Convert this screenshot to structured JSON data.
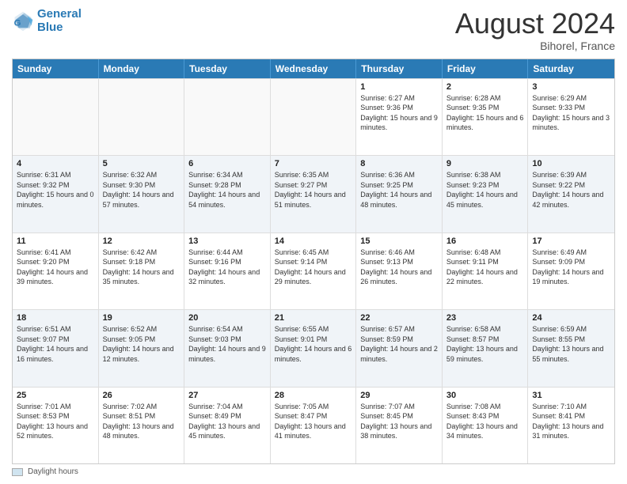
{
  "header": {
    "logo_line1": "General",
    "logo_line2": "Blue",
    "month": "August 2024",
    "location": "Bihorel, France"
  },
  "calendar": {
    "days_of_week": [
      "Sunday",
      "Monday",
      "Tuesday",
      "Wednesday",
      "Thursday",
      "Friday",
      "Saturday"
    ],
    "rows": [
      [
        {
          "day": "",
          "info": ""
        },
        {
          "day": "",
          "info": ""
        },
        {
          "day": "",
          "info": ""
        },
        {
          "day": "",
          "info": ""
        },
        {
          "day": "1",
          "info": "Sunrise: 6:27 AM\nSunset: 9:36 PM\nDaylight: 15 hours and 9 minutes."
        },
        {
          "day": "2",
          "info": "Sunrise: 6:28 AM\nSunset: 9:35 PM\nDaylight: 15 hours and 6 minutes."
        },
        {
          "day": "3",
          "info": "Sunrise: 6:29 AM\nSunset: 9:33 PM\nDaylight: 15 hours and 3 minutes."
        }
      ],
      [
        {
          "day": "4",
          "info": "Sunrise: 6:31 AM\nSunset: 9:32 PM\nDaylight: 15 hours and 0 minutes."
        },
        {
          "day": "5",
          "info": "Sunrise: 6:32 AM\nSunset: 9:30 PM\nDaylight: 14 hours and 57 minutes."
        },
        {
          "day": "6",
          "info": "Sunrise: 6:34 AM\nSunset: 9:28 PM\nDaylight: 14 hours and 54 minutes."
        },
        {
          "day": "7",
          "info": "Sunrise: 6:35 AM\nSunset: 9:27 PM\nDaylight: 14 hours and 51 minutes."
        },
        {
          "day": "8",
          "info": "Sunrise: 6:36 AM\nSunset: 9:25 PM\nDaylight: 14 hours and 48 minutes."
        },
        {
          "day": "9",
          "info": "Sunrise: 6:38 AM\nSunset: 9:23 PM\nDaylight: 14 hours and 45 minutes."
        },
        {
          "day": "10",
          "info": "Sunrise: 6:39 AM\nSunset: 9:22 PM\nDaylight: 14 hours and 42 minutes."
        }
      ],
      [
        {
          "day": "11",
          "info": "Sunrise: 6:41 AM\nSunset: 9:20 PM\nDaylight: 14 hours and 39 minutes."
        },
        {
          "day": "12",
          "info": "Sunrise: 6:42 AM\nSunset: 9:18 PM\nDaylight: 14 hours and 35 minutes."
        },
        {
          "day": "13",
          "info": "Sunrise: 6:44 AM\nSunset: 9:16 PM\nDaylight: 14 hours and 32 minutes."
        },
        {
          "day": "14",
          "info": "Sunrise: 6:45 AM\nSunset: 9:14 PM\nDaylight: 14 hours and 29 minutes."
        },
        {
          "day": "15",
          "info": "Sunrise: 6:46 AM\nSunset: 9:13 PM\nDaylight: 14 hours and 26 minutes."
        },
        {
          "day": "16",
          "info": "Sunrise: 6:48 AM\nSunset: 9:11 PM\nDaylight: 14 hours and 22 minutes."
        },
        {
          "day": "17",
          "info": "Sunrise: 6:49 AM\nSunset: 9:09 PM\nDaylight: 14 hours and 19 minutes."
        }
      ],
      [
        {
          "day": "18",
          "info": "Sunrise: 6:51 AM\nSunset: 9:07 PM\nDaylight: 14 hours and 16 minutes."
        },
        {
          "day": "19",
          "info": "Sunrise: 6:52 AM\nSunset: 9:05 PM\nDaylight: 14 hours and 12 minutes."
        },
        {
          "day": "20",
          "info": "Sunrise: 6:54 AM\nSunset: 9:03 PM\nDaylight: 14 hours and 9 minutes."
        },
        {
          "day": "21",
          "info": "Sunrise: 6:55 AM\nSunset: 9:01 PM\nDaylight: 14 hours and 6 minutes."
        },
        {
          "day": "22",
          "info": "Sunrise: 6:57 AM\nSunset: 8:59 PM\nDaylight: 14 hours and 2 minutes."
        },
        {
          "day": "23",
          "info": "Sunrise: 6:58 AM\nSunset: 8:57 PM\nDaylight: 13 hours and 59 minutes."
        },
        {
          "day": "24",
          "info": "Sunrise: 6:59 AM\nSunset: 8:55 PM\nDaylight: 13 hours and 55 minutes."
        }
      ],
      [
        {
          "day": "25",
          "info": "Sunrise: 7:01 AM\nSunset: 8:53 PM\nDaylight: 13 hours and 52 minutes."
        },
        {
          "day": "26",
          "info": "Sunrise: 7:02 AM\nSunset: 8:51 PM\nDaylight: 13 hours and 48 minutes."
        },
        {
          "day": "27",
          "info": "Sunrise: 7:04 AM\nSunset: 8:49 PM\nDaylight: 13 hours and 45 minutes."
        },
        {
          "day": "28",
          "info": "Sunrise: 7:05 AM\nSunset: 8:47 PM\nDaylight: 13 hours and 41 minutes."
        },
        {
          "day": "29",
          "info": "Sunrise: 7:07 AM\nSunset: 8:45 PM\nDaylight: 13 hours and 38 minutes."
        },
        {
          "day": "30",
          "info": "Sunrise: 7:08 AM\nSunset: 8:43 PM\nDaylight: 13 hours and 34 minutes."
        },
        {
          "day": "31",
          "info": "Sunrise: 7:10 AM\nSunset: 8:41 PM\nDaylight: 13 hours and 31 minutes."
        }
      ]
    ]
  },
  "footer": {
    "legend_label": "Daylight hours"
  }
}
